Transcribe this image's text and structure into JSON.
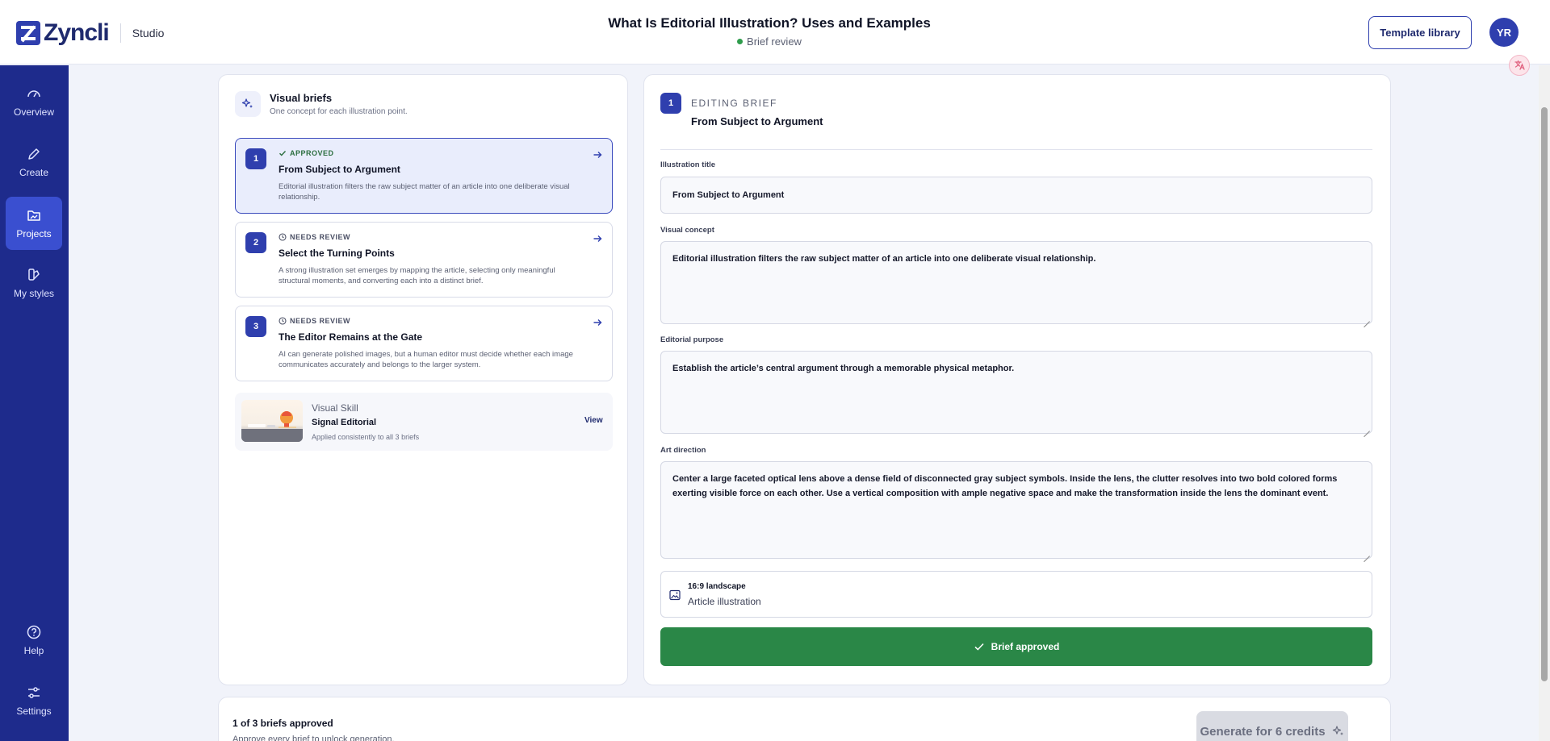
{
  "header": {
    "brand": "Zyncli",
    "section": "Studio",
    "title": "What Is Editorial Illustration? Uses and Examples",
    "status": "Brief review",
    "template_button": "Template library",
    "avatar_initials": "YR"
  },
  "sidebar": {
    "items": [
      {
        "label": "Overview",
        "icon": "gauge-icon"
      },
      {
        "label": "Create",
        "icon": "pencil-icon"
      },
      {
        "label": "Projects",
        "icon": "folder-image-icon",
        "active": true
      },
      {
        "label": "My styles",
        "icon": "palette-icon"
      }
    ],
    "bottom": [
      {
        "label": "Help",
        "icon": "help-icon"
      },
      {
        "label": "Settings",
        "icon": "sliders-icon"
      }
    ]
  },
  "briefs": {
    "title": "Visual briefs",
    "subtitle": "One concept for each illustration point.",
    "items": [
      {
        "num": "1",
        "status": "APPROVED",
        "title": "From Subject to Argument",
        "desc": "Editorial illustration filters the raw subject matter of an article into one deliberate visual relationship."
      },
      {
        "num": "2",
        "status": "NEEDS REVIEW",
        "title": "Select the Turning Points",
        "desc": "A strong illustration set emerges by mapping the article, selecting only meaningful structural moments, and converting each into a distinct brief."
      },
      {
        "num": "3",
        "status": "NEEDS REVIEW",
        "title": "The Editor Remains at the Gate",
        "desc": "AI can generate polished images, but a human editor must decide whether each image communicates accurately and belongs to the larger system."
      }
    ],
    "skill": {
      "label": "Visual Skill",
      "name": "Signal Editorial",
      "sub": "Applied consistently to all 3 briefs",
      "view": "View"
    }
  },
  "editor": {
    "num": "1",
    "kicker": "EDITING BRIEF",
    "title": "From Subject to Argument",
    "fields": {
      "illustration_title_label": "Illustration title",
      "illustration_title": "From Subject to Argument",
      "visual_concept_label": "Visual concept",
      "visual_concept": "Editorial illustration filters the raw subject matter of an article into one deliberate visual relationship.",
      "editorial_purpose_label": "Editorial purpose",
      "editorial_purpose": "Establish the article’s central argument through a memorable physical metaphor.",
      "art_direction_label": "Art direction",
      "art_direction": "Center a large faceted optical lens above a dense field of disconnected gray subject symbols. Inside the lens, the clutter resolves into two bold colored forms exerting visible force on each other. Use a vertical composition with ample negative space and make the transformation inside the lens the dominant event."
    },
    "aspect": {
      "ratio": "16:9 landscape",
      "type": "Article illustration"
    },
    "approve_button": "Brief approved"
  },
  "footer": {
    "count": "1 of 3 briefs approved",
    "hint": "Approve every brief to unlock generation.",
    "generate_button": "Generate for 6 credits"
  },
  "colors": {
    "brand": "#1e2b8c",
    "accent": "#2f3fae",
    "success": "#2a8747"
  }
}
